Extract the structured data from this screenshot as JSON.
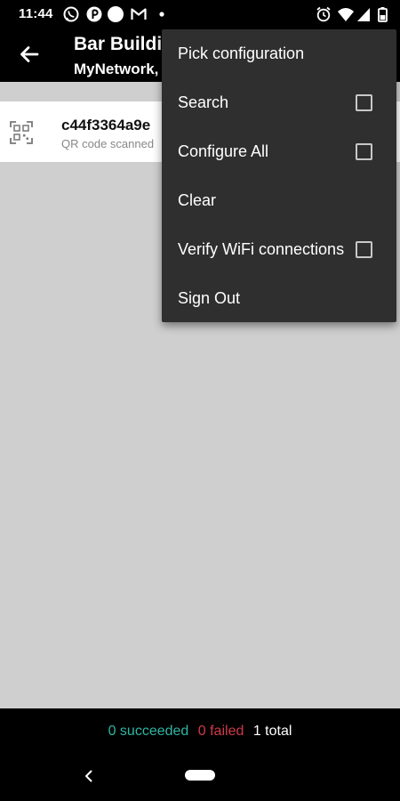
{
  "status_bar": {
    "time": "11:44",
    "left_icons": [
      "whatsapp-icon",
      "pinterest-icon",
      "circle-icon",
      "gmail-icon",
      "dot-icon"
    ],
    "right_icons": [
      "alarm-icon",
      "wifi-icon",
      "cellular-icon",
      "battery-icon"
    ]
  },
  "app_bar": {
    "title": "Bar Buildi",
    "subtitle": "MyNetwork,"
  },
  "list": {
    "items": [
      {
        "title": "c44f3364a9e",
        "subtitle": "QR code scanned",
        "icon": "qr-code-icon"
      }
    ]
  },
  "menu": {
    "items": [
      {
        "label": "Pick configuration",
        "has_checkbox": false
      },
      {
        "label": "Search",
        "has_checkbox": true,
        "checked": false
      },
      {
        "label": "Configure All",
        "has_checkbox": true,
        "checked": false
      },
      {
        "label": "Clear",
        "has_checkbox": false
      },
      {
        "label": "Verify WiFi connections",
        "has_checkbox": true,
        "checked": false
      },
      {
        "label": "Sign Out",
        "has_checkbox": false
      }
    ]
  },
  "footer": {
    "succeeded": "0 succeeded",
    "failed": "0 failed",
    "total": "1 total"
  },
  "colors": {
    "succeeded": "#2fb6a4",
    "failed": "#d23a4a",
    "menu_bg": "#2f2f2f",
    "content_bg": "#cfcfcf"
  }
}
